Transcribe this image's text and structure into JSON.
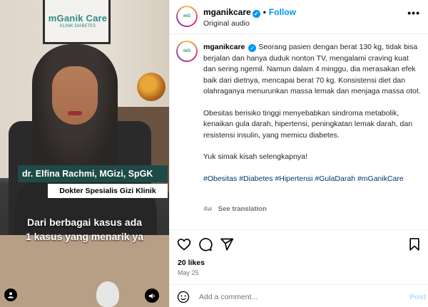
{
  "media": {
    "logo_main": "mGanik Care",
    "logo_sub": "KLINIK DIABETES",
    "doctor_name": "dr. Elfina Rachmi, MGizi, SpGK",
    "doctor_title": "Dokter Spesialis Gizi Klinik",
    "caption_line1": "Dari berbagai kasus ada",
    "caption_line2": "1 kasus yang menarik ya",
    "user_icon": "user-icon",
    "sound_icon": "volume-icon"
  },
  "header": {
    "username": "mganikcare",
    "verified_mark": "✓",
    "separator": "•",
    "follow_label": "Follow",
    "audio_label": "Original audio",
    "more_label": "•••"
  },
  "post": {
    "username": "mganikcare",
    "paragraph1": "Seorang pasien dengan berat 130 kg, tidak bisa berjalan dan hanya duduk nonton TV, mengalami craving kuat dan sering ngemil. Namun dalam 4 minggu, dia merasakan efek baik dari dietnya, mencapai berat 70 kg. Konsistensi diet dan olahraganya menurunkan massa lemak dan menjaga massa otot.",
    "paragraph2": "Obesitas berisiko tinggi menyebabkan sindroma metabolik, kenaikan gula darah, hipertensi, peningkatan lemak darah, dan resistensi insulin, yang memicu diabetes.",
    "paragraph3": "Yuk simak kisah selengkapnya!",
    "hashtags": "#Obesitas #Diabetes #Hipertensi #GulaDarah #mGanikCare",
    "age": "4w",
    "translation_label": "See translation"
  },
  "actions": {
    "likes": "20 likes",
    "date": "May 25"
  },
  "comment_box": {
    "placeholder": "Add a comment...",
    "post_label": "Post"
  },
  "colors": {
    "accent": "#0095f6",
    "hashtag": "#00376b",
    "name_bar": "#1e4a47"
  }
}
